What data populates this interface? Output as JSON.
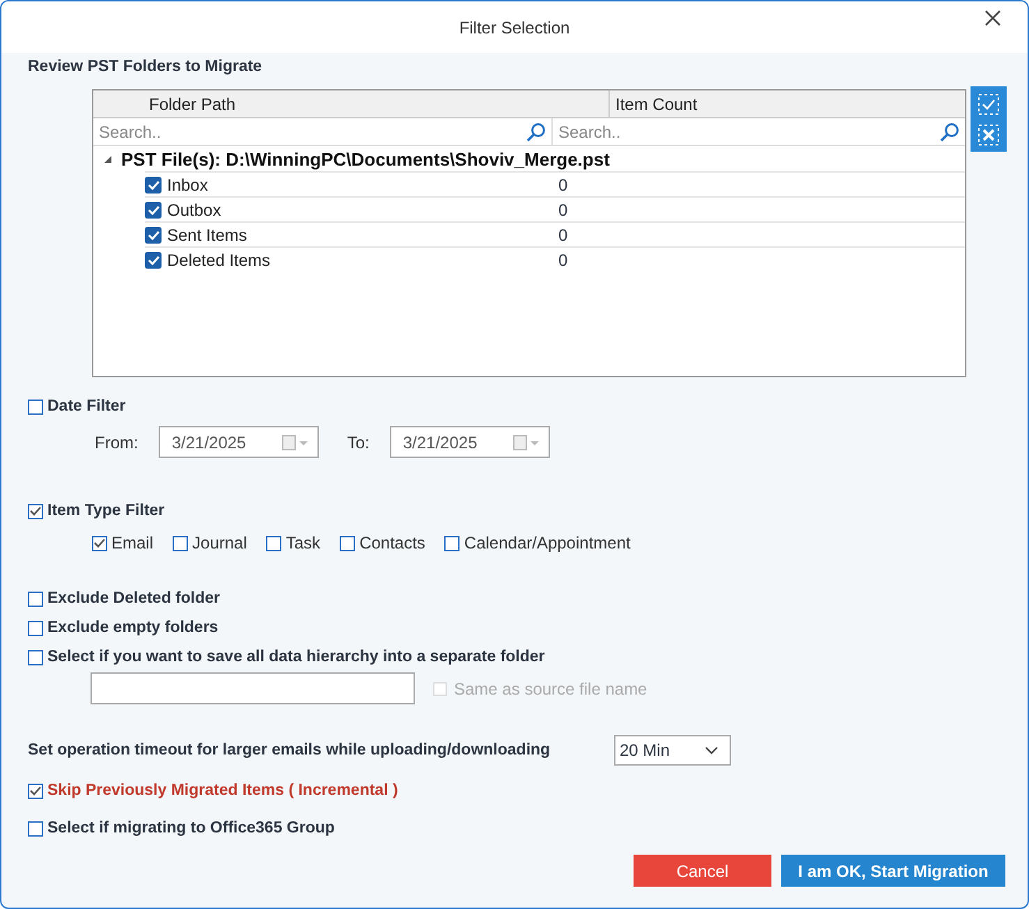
{
  "window": {
    "title": "Filter Selection"
  },
  "section_label": "Review PST Folders to Migrate",
  "grid": {
    "columns": [
      "Folder Path",
      "Item Count"
    ],
    "search_placeholders": [
      "Search..",
      "Search.."
    ],
    "root": {
      "label": "PST File(s): D:\\WinningPC\\Documents\\Shoviv_Merge.pst",
      "expanded": true,
      "children": [
        {
          "name": "Inbox",
          "count": "0",
          "checked": true
        },
        {
          "name": "Outbox",
          "count": "0",
          "checked": true
        },
        {
          "name": "Sent Items",
          "count": "0",
          "checked": true
        },
        {
          "name": "Deleted Items",
          "count": "0",
          "checked": true
        }
      ]
    }
  },
  "date_filter": {
    "label": "Date Filter",
    "checked": false,
    "from_label": "From:",
    "from_value": "3/21/2025",
    "to_label": "To:",
    "to_value": "3/21/2025"
  },
  "item_type_filter": {
    "label": "Item Type Filter",
    "checked": true,
    "types": [
      {
        "label": "Email",
        "checked": true
      },
      {
        "label": "Journal",
        "checked": false
      },
      {
        "label": "Task",
        "checked": false
      },
      {
        "label": "Contacts",
        "checked": false
      },
      {
        "label": "Calendar/Appointment",
        "checked": false
      }
    ]
  },
  "options": [
    {
      "label": "Exclude Deleted folder",
      "checked": false
    },
    {
      "label": "Exclude empty folders",
      "checked": false
    },
    {
      "label": "Select if you want to save all data hierarchy into a separate folder",
      "checked": false
    }
  ],
  "same_as_source": {
    "label": "Same as source file name",
    "checked": false,
    "disabled": true
  },
  "timeout": {
    "label": "Set operation timeout for larger emails while uploading/downloading",
    "value": "20 Min"
  },
  "skip_incremental": {
    "label": "Skip Previously Migrated Items ( Incremental )",
    "checked": true
  },
  "office365_group": {
    "label": "Select if migrating to Office365 Group",
    "checked": false
  },
  "buttons": [
    {
      "label": "Cancel",
      "kind": "cancel"
    },
    {
      "label": "I am OK, Start Migration",
      "kind": "primary"
    }
  ]
}
